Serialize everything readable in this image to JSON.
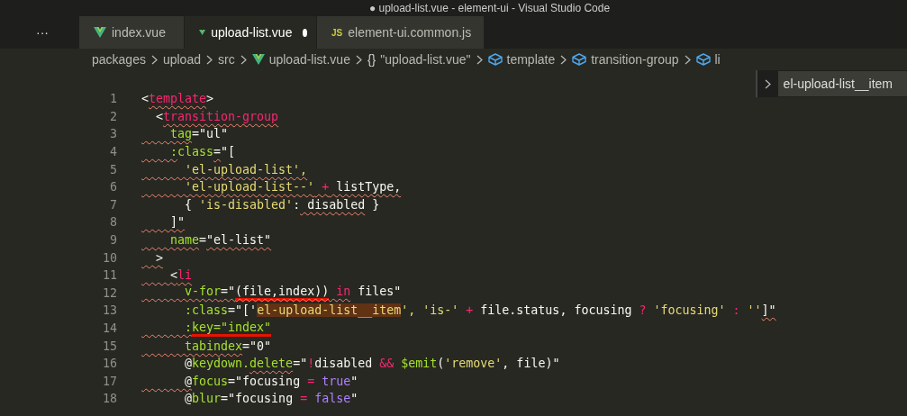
{
  "window": {
    "title": "● upload-list.vue - element-ui - Visual Studio Code"
  },
  "more_button": "···",
  "tabs": [
    {
      "label": "index.vue",
      "kind": "vue",
      "selected": false,
      "modified": false
    },
    {
      "label": "upload-list.vue",
      "kind": "vue",
      "selected": true,
      "modified": true
    },
    {
      "label": "element-ui.common.js",
      "kind": "js",
      "icon_text": "JS",
      "selected": false,
      "modified": false
    }
  ],
  "breadcrumbs": [
    {
      "label": "packages",
      "kind": "folder"
    },
    {
      "label": "upload",
      "kind": "folder"
    },
    {
      "label": "src",
      "kind": "folder"
    },
    {
      "label": "upload-list.vue",
      "kind": "vue"
    },
    {
      "label": "\"upload-list.vue\"",
      "kind": "object",
      "glyph": "{}"
    },
    {
      "label": "template",
      "kind": "element"
    },
    {
      "label": "transition-group",
      "kind": "element"
    },
    {
      "label": "li",
      "kind": "element"
    }
  ],
  "breadcrumb_dropdown": {
    "items": [
      {
        "label": "el-upload-list__item",
        "selected": true
      }
    ]
  },
  "editor": {
    "lines": [
      {
        "number": "1",
        "tokens": [
          {
            "text": "<",
            "kind": "plain"
          },
          {
            "text": "template",
            "kind": "tag",
            "squiggle": true
          },
          {
            "text": ">",
            "kind": "plain"
          }
        ]
      },
      {
        "number": "2",
        "tokens": [
          {
            "text": "  <",
            "kind": "plain"
          },
          {
            "text": "transition-group",
            "kind": "tag",
            "squiggle": true
          }
        ]
      },
      {
        "number": "3",
        "tokens": [
          {
            "text": "    tag",
            "kind": "attr",
            "squiggle": true
          },
          {
            "text": "=",
            "kind": "plain"
          },
          {
            "text": "\"ul\"",
            "kind": "value"
          }
        ]
      },
      {
        "number": "4",
        "tokens": [
          {
            "text": "    :",
            "kind": "attr",
            "squiggle": true
          },
          {
            "text": "class",
            "kind": "attr"
          },
          {
            "text": "=",
            "kind": "plain",
            "squiggle": true
          },
          {
            "text": "\"[",
            "kind": "value"
          }
        ]
      },
      {
        "number": "5",
        "tokens": [
          {
            "text": "      'el-upload-list',",
            "kind": "str",
            "squiggle": true
          }
        ]
      },
      {
        "number": "6",
        "tokens": [
          {
            "text": "      'el-upload-list--'",
            "kind": "str",
            "squiggle": true
          },
          {
            "text": " +",
            "kind": "op",
            "squiggle": true
          },
          {
            "text": " listType,",
            "kind": "plain",
            "squiggle": true
          }
        ]
      },
      {
        "number": "7",
        "tokens": [
          {
            "text": "      {",
            "kind": "plain"
          },
          {
            "text": " 'is-disabled'",
            "kind": "str"
          },
          {
            "text": ":",
            "kind": "plain"
          },
          {
            "text": " disabled",
            "kind": "plain",
            "squiggle": true
          },
          {
            "text": " }",
            "kind": "plain"
          }
        ]
      },
      {
        "number": "8",
        "tokens": [
          {
            "text": "    ]\"",
            "kind": "value",
            "squiggle": true
          }
        ]
      },
      {
        "number": "9",
        "tokens": [
          {
            "text": "    name",
            "kind": "attr",
            "squiggle": true
          },
          {
            "text": "=",
            "kind": "plain"
          },
          {
            "text": "\"el-list\"",
            "kind": "value",
            "squiggle": true
          }
        ]
      },
      {
        "number": "10",
        "tokens": [
          {
            "text": "  >",
            "kind": "plain",
            "squiggle": true
          }
        ]
      },
      {
        "number": "11",
        "tokens": [
          {
            "text": "    <",
            "kind": "plain",
            "squiggle": true
          },
          {
            "text": "li",
            "kind": "tag",
            "squiggle": true
          }
        ]
      },
      {
        "number": "12",
        "tokens": [
          {
            "text": "      v-for",
            "kind": "attr",
            "squiggle": true
          },
          {
            "text": "=\"",
            "kind": "value",
            "squiggle": true
          },
          {
            "text": "(file,index))",
            "kind": "value",
            "squiggle": true,
            "marked": true
          },
          {
            "text": " in",
            "kind": "op",
            "squiggle": true
          },
          {
            "text": " files\"",
            "kind": "value"
          }
        ]
      },
      {
        "number": "13",
        "tokens": [
          {
            "text": "      :class",
            "kind": "attr"
          },
          {
            "text": "=",
            "kind": "plain"
          },
          {
            "text": "\"['",
            "kind": "value"
          },
          {
            "text": "el-upload-list__item",
            "kind": "str",
            "highlighted": true
          },
          {
            "text": "',",
            "kind": "str"
          },
          {
            "text": " 'is-'",
            "kind": "str"
          },
          {
            "text": " +",
            "kind": "op"
          },
          {
            "text": " file.status, focusing",
            "kind": "plain"
          },
          {
            "text": " ?",
            "kind": "op"
          },
          {
            "text": " 'focusing'",
            "kind": "str"
          },
          {
            "text": " :",
            "kind": "op"
          },
          {
            "text": " ''",
            "kind": "str"
          },
          {
            "text": "]\"",
            "kind": "value",
            "squiggle": true
          }
        ]
      },
      {
        "number": "14",
        "tokens": [
          {
            "text": "      :",
            "kind": "attr",
            "squiggle": true
          },
          {
            "text": "key=\"index\"",
            "kind": "attr",
            "marked": true
          }
        ]
      },
      {
        "number": "15",
        "tokens": [
          {
            "text": "      tabindex",
            "kind": "attr",
            "squiggle": true
          },
          {
            "text": "=",
            "kind": "plain"
          },
          {
            "text": "\"0\"",
            "kind": "value"
          }
        ]
      },
      {
        "number": "16",
        "tokens": [
          {
            "text": "      @",
            "kind": "plain"
          },
          {
            "text": "keydown.",
            "kind": "attr"
          },
          {
            "text": "delete",
            "kind": "attr",
            "squiggle": true
          },
          {
            "text": "=\"",
            "kind": "plain"
          },
          {
            "text": "!",
            "kind": "op"
          },
          {
            "text": "disabled",
            "kind": "plain"
          },
          {
            "text": " &&",
            "kind": "op"
          },
          {
            "text": " $emit",
            "kind": "attr"
          },
          {
            "text": "(",
            "kind": "plain"
          },
          {
            "text": "'remove'",
            "kind": "str"
          },
          {
            "text": ", file)\"",
            "kind": "plain"
          }
        ]
      },
      {
        "number": "17",
        "tokens": [
          {
            "text": "      @",
            "kind": "plain",
            "squiggle": true
          },
          {
            "text": "focus",
            "kind": "attr"
          },
          {
            "text": "=\"focusing",
            "kind": "plain"
          },
          {
            "text": " =",
            "kind": "op"
          },
          {
            "text": " true",
            "kind": "kw"
          },
          {
            "text": "\"",
            "kind": "plain"
          }
        ]
      },
      {
        "number": "18",
        "tokens": [
          {
            "text": "      @",
            "kind": "plain"
          },
          {
            "text": "blur",
            "kind": "attr"
          },
          {
            "text": "=\"focusing",
            "kind": "plain"
          },
          {
            "text": " =",
            "kind": "op"
          },
          {
            "text": " false",
            "kind": "kw"
          },
          {
            "text": "\"",
            "kind": "plain"
          }
        ]
      }
    ]
  }
}
